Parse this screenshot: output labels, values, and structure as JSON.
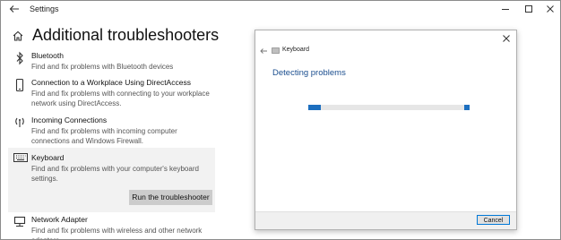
{
  "window": {
    "title": "Settings"
  },
  "page": {
    "title": "Additional troubleshooters"
  },
  "troubleshooters": [
    {
      "name": "Bluetooth",
      "description": "Find and fix problems with Bluetooth devices",
      "icon": "bluetooth-icon"
    },
    {
      "name": "Connection to a Workplace Using DirectAccess",
      "description": "Find and fix problems with connecting to your workplace network using DirectAccess.",
      "icon": "phone-icon"
    },
    {
      "name": "Incoming Connections",
      "description": "Find and fix problems with incoming computer connections and Windows Firewall.",
      "icon": "signal-icon"
    },
    {
      "name": "Keyboard",
      "description": "Find and fix problems with your computer's keyboard settings.",
      "icon": "keyboard-icon",
      "selected": true,
      "action_label": "Run the troubleshooter"
    },
    {
      "name": "Network Adapter",
      "description": "Find and fix problems with wireless and other network adapters.",
      "icon": "network-adapter-icon"
    }
  ],
  "dialog": {
    "title": "Keyboard",
    "status": "Detecting problems",
    "cancel_label": "Cancel",
    "progress_state": "indeterminate"
  },
  "colors": {
    "accent": "#1d6fbf",
    "status_text": "#1b4e8f",
    "selected_bg": "#f2f2f2",
    "button_bg": "#cccccc"
  }
}
